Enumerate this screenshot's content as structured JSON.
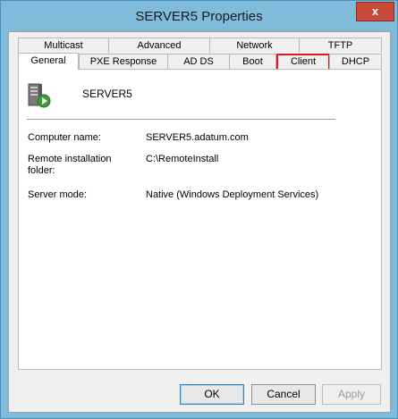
{
  "window": {
    "title": "SERVER5 Properties",
    "close_glyph": "x"
  },
  "tabs": {
    "row_back": [
      "Multicast",
      "Advanced",
      "Network",
      "TFTP"
    ],
    "row_front": [
      "General",
      "PXE Response",
      "AD DS",
      "Boot",
      "Client",
      "DHCP"
    ],
    "selected": "General",
    "highlighted": "Client",
    "highlight_color": "#e0191f"
  },
  "general": {
    "server_icon": "server-icon",
    "server_name": "SERVER5",
    "fields": [
      {
        "label": "Computer name:",
        "value": "SERVER5.adatum.com"
      },
      {
        "label": "Remote installation folder:",
        "value": "C:\\RemoteInstall"
      },
      {
        "label": "Server mode:",
        "value": "Native (Windows Deployment Services)"
      }
    ]
  },
  "buttons": {
    "ok": "OK",
    "cancel": "Cancel",
    "apply": "Apply"
  }
}
